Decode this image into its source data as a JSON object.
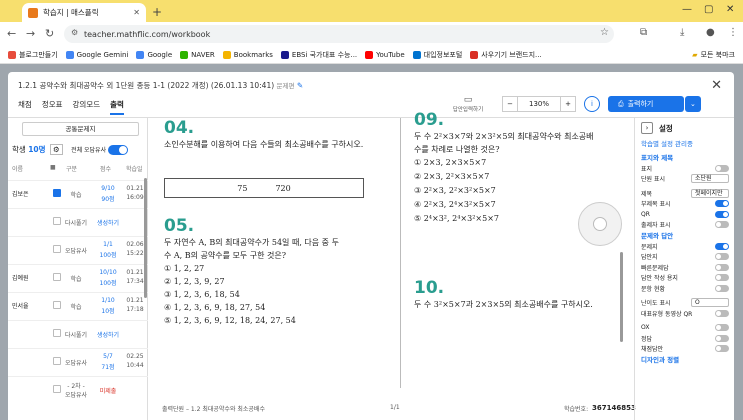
{
  "browser": {
    "tab_title": "학습지 | 매스플릭",
    "url": "teacher.mathflic.com/workbook",
    "bookmarks": [
      "블로그만들기",
      "Google Gemini",
      "Google",
      "NAVER",
      "Bookmarks",
      "EBSi 국가대표 수능...",
      "YouTube",
      "대입정보포털",
      "사우기기 브랜드지..."
    ],
    "bookmark_right": "모든 북마크",
    "bookmark_colors": [
      "#e74c3c",
      "#4285f4",
      "#4285f4",
      "#2db400",
      "#f4b400",
      "#1a1a8c",
      "#ff0000",
      "#0073cf",
      "#d93025"
    ]
  },
  "modal": {
    "title": "1.2.1 공약수와 최대공약수 외 1단원 종등 1-1 (2022 개정) (26.01.13 10:41)",
    "title_sub": "문제편",
    "tabs": [
      "채점",
      "정오표",
      "강의모드",
      "출력"
    ],
    "active_tab": "출력",
    "toolbar": {
      "layout_label": "답안입력하기",
      "zoom": "130%",
      "print_label": "출력하기"
    }
  },
  "left": {
    "common_button": "공통문제지",
    "students_label": "학생",
    "students_count": "10명",
    "all_wrong_label": "전체 오답유사",
    "headers": [
      "이름",
      "구분",
      "점수",
      "학습일"
    ],
    "rows": [
      {
        "name": "김보은",
        "type": "학습",
        "score": "9/10",
        "score2": "90점",
        "date": "01.21",
        "date2": "16:09",
        "checked": true
      },
      {
        "name": "",
        "type": "다시풀기",
        "score": "생성하기",
        "score2": "",
        "date": "",
        "date2": "",
        "checked": false
      },
      {
        "name": "",
        "type": "오답유사",
        "score": "1/1",
        "score2": "100점",
        "date": "02.06",
        "date2": "15:22",
        "checked": false
      },
      {
        "name": "김예원",
        "type": "학습",
        "score": "10/10",
        "score2": "100점",
        "date": "01.21",
        "date2": "17:34",
        "checked": false
      },
      {
        "name": "민서율",
        "type": "학습",
        "score": "1/10",
        "score2": "10점",
        "date": "01.21",
        "date2": "17:18",
        "checked": false
      },
      {
        "name": "",
        "type": "다시풀기",
        "score": "생성하기",
        "score2": "",
        "date": "",
        "date2": "",
        "checked": false
      },
      {
        "name": "",
        "type": "오답유사",
        "score": "5/7",
        "score2": "71점",
        "date": "02.25",
        "date2": "10:44",
        "checked": false
      },
      {
        "name": "",
        "type": "- 2차 -",
        "type2": "오답유사",
        "score": "미제출",
        "score2": "",
        "date": "",
        "date2": "",
        "checked": false
      }
    ]
  },
  "paper": {
    "q4": {
      "num": "04.",
      "text": "소인수분해를 이용하여 다음 수들의 최소공배수를 구하시오.",
      "values": [
        "75",
        "720"
      ]
    },
    "q5": {
      "num": "05.",
      "text1": "두 자연수 A, B의 최대공약수가 54일 때, 다음 중 두",
      "text2": "수 A, B의 공약수를 모두 구한 것은?",
      "choices": [
        "① 1, 2, 27",
        "② 1, 2, 3, 9, 27",
        "③ 1, 2, 3, 6, 18, 54",
        "④ 1, 2, 3, 6, 9, 18, 27, 54",
        "⑤ 1, 2, 3, 6, 9, 12, 18, 24, 27, 54"
      ]
    },
    "q9": {
      "num": "09.",
      "text1": "두 수 2²×3×7와 2×3²×5의 최대공약수와 최소공배",
      "text2": "수를 차례로 나열한 것은?",
      "choices": [
        "① 2×3, 2×3×5×7",
        "② 2×3, 2²×3×5×7",
        "③ 2²×3, 2²×3²×5×7",
        "④ 2²×3, 2⁴×3²×5×7",
        "⑤ 2⁴×3², 2⁴×3²×5×7"
      ]
    },
    "q10": {
      "num": "10.",
      "text": "두 수 3²×5×7과 2×3×5의 최소공배수를 구하시오."
    },
    "footer_left": "출력단원 – 1.2 최대공약수와 최소공배수",
    "footer_page": "1/1",
    "footer_code_label": "학습번호:",
    "footer_code": "367146853"
  },
  "right": {
    "title": "설정",
    "sub": "학습별 설정 관리중",
    "sections": [
      {
        "head": "표지와 제목",
        "items": [
          {
            "label": "표지",
            "type": "toggle",
            "on": false
          },
          {
            "label": "단원 표시",
            "type": "select",
            "value": "소단원"
          }
        ]
      },
      {
        "head": "",
        "items": [
          {
            "label": "제목",
            "type": "select",
            "value": "첫페이지만"
          },
          {
            "label": "부제목 표시",
            "type": "toggle",
            "on": true
          },
          {
            "label": "QR",
            "type": "toggle",
            "on": true
          },
          {
            "label": "출제자 표시",
            "type": "toggle",
            "on": false
          }
        ]
      },
      {
        "head": "문제와 답안",
        "items": [
          {
            "label": "문제지",
            "type": "toggle",
            "on": true
          },
          {
            "label": "답안지",
            "type": "toggle",
            "on": false
          },
          {
            "label": "빠른문제답",
            "type": "toggle",
            "on": false
          },
          {
            "label": "답안 작성 용지",
            "type": "toggle",
            "on": false
          },
          {
            "label": "문항 현황",
            "type": "toggle",
            "on": false
          }
        ]
      },
      {
        "head": "",
        "items": [
          {
            "label": "난이도 표시",
            "type": "select",
            "value": "O"
          },
          {
            "label": "대표유형 동영상 QR",
            "type": "toggle",
            "on": false
          }
        ]
      },
      {
        "head": "",
        "items": [
          {
            "label": "OX",
            "type": "toggle",
            "on": false
          },
          {
            "label": "정답",
            "type": "toggle",
            "on": false
          },
          {
            "label": "채점답안",
            "type": "toggle",
            "on": false
          }
        ]
      },
      {
        "head": "디자인과 정렬",
        "items": []
      }
    ]
  }
}
